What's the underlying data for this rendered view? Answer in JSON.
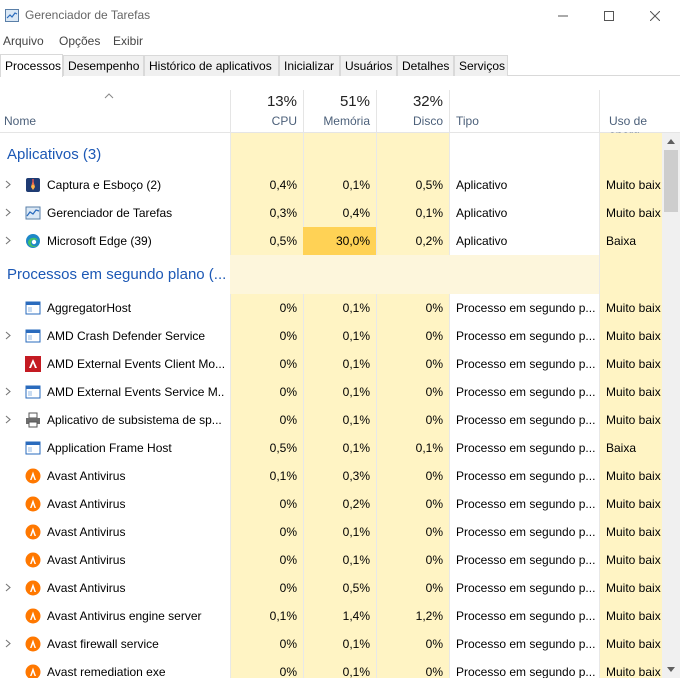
{
  "window": {
    "title": "Gerenciador de Tarefas",
    "minimize": "—",
    "maximize": "☐",
    "close": "✕"
  },
  "menu": [
    "Arquivo",
    "Opções",
    "Exibir"
  ],
  "tabs": [
    "Processos",
    "Desempenho",
    "Histórico de aplicativos",
    "Inicializar",
    "Usuários",
    "Detalhes",
    "Serviços"
  ],
  "active_tab": "Processos",
  "columns": {
    "name": "Nome",
    "cpu": {
      "label": "CPU",
      "pct": "13%"
    },
    "memory": {
      "label": "Memória",
      "pct": "51%"
    },
    "disk": {
      "label": "Disco",
      "pct": "32%"
    },
    "type": "Tipo",
    "energy": "Uso de energ"
  },
  "groups": {
    "apps": "Aplicativos (3)",
    "background": "Processos em segundo plano (..."
  },
  "apps": [
    {
      "name": "Captura e Esboço (2)",
      "cpu": "0,4%",
      "mem": "0,1%",
      "disk": "0,5%",
      "type": "Aplicativo",
      "energy": "Muito baix",
      "icon": "snip-sketch-icon",
      "expand": true,
      "mem_heat": 0
    },
    {
      "name": "Gerenciador de Tarefas",
      "cpu": "0,3%",
      "mem": "0,4%",
      "disk": "0,1%",
      "type": "Aplicativo",
      "energy": "Muito baix",
      "icon": "task-manager-icon",
      "expand": true,
      "mem_heat": 0
    },
    {
      "name": "Microsoft Edge (39)",
      "cpu": "0,5%",
      "mem": "30,0%",
      "disk": "0,2%",
      "type": "Aplicativo",
      "energy": "Baixa",
      "icon": "edge-icon",
      "expand": true,
      "mem_heat": 2
    }
  ],
  "background": [
    {
      "name": "AggregatorHost",
      "cpu": "0%",
      "mem": "0,1%",
      "disk": "0%",
      "type": "Processo em segundo p...",
      "energy": "Muito baix",
      "icon": "window-app-icon",
      "expand": false
    },
    {
      "name": "AMD Crash Defender Service",
      "cpu": "0%",
      "mem": "0,1%",
      "disk": "0%",
      "type": "Processo em segundo p...",
      "energy": "Muito baix",
      "icon": "window-app-icon",
      "expand": true
    },
    {
      "name": "AMD External Events Client Mo...",
      "cpu": "0%",
      "mem": "0,1%",
      "disk": "0%",
      "type": "Processo em segundo p...",
      "energy": "Muito baix",
      "icon": "amd-icon",
      "expand": false
    },
    {
      "name": "AMD External Events Service M...",
      "cpu": "0%",
      "mem": "0,1%",
      "disk": "0%",
      "type": "Processo em segundo p...",
      "energy": "Muito baix",
      "icon": "window-app-icon",
      "expand": true
    },
    {
      "name": "Aplicativo de subsistema de sp...",
      "cpu": "0%",
      "mem": "0,1%",
      "disk": "0%",
      "type": "Processo em segundo p...",
      "energy": "Muito baix",
      "icon": "printer-icon",
      "expand": true
    },
    {
      "name": "Application Frame Host",
      "cpu": "0,5%",
      "mem": "0,1%",
      "disk": "0,1%",
      "type": "Processo em segundo p...",
      "energy": "Baixa",
      "icon": "window-app-icon",
      "expand": false
    },
    {
      "name": "Avast Antivirus",
      "cpu": "0,1%",
      "mem": "0,3%",
      "disk": "0%",
      "type": "Processo em segundo p...",
      "energy": "Muito baix",
      "icon": "avast-icon",
      "expand": false
    },
    {
      "name": "Avast Antivirus",
      "cpu": "0%",
      "mem": "0,2%",
      "disk": "0%",
      "type": "Processo em segundo p...",
      "energy": "Muito baix",
      "icon": "avast-icon",
      "expand": false
    },
    {
      "name": "Avast Antivirus",
      "cpu": "0%",
      "mem": "0,1%",
      "disk": "0%",
      "type": "Processo em segundo p...",
      "energy": "Muito baix",
      "icon": "avast-icon",
      "expand": false
    },
    {
      "name": "Avast Antivirus",
      "cpu": "0%",
      "mem": "0,1%",
      "disk": "0%",
      "type": "Processo em segundo p...",
      "energy": "Muito baix",
      "icon": "avast-icon",
      "expand": false
    },
    {
      "name": "Avast Antivirus",
      "cpu": "0%",
      "mem": "0,5%",
      "disk": "0%",
      "type": "Processo em segundo p...",
      "energy": "Muito baix",
      "icon": "avast-icon",
      "expand": true
    },
    {
      "name": "Avast Antivirus engine server",
      "cpu": "0,1%",
      "mem": "1,4%",
      "disk": "1,2%",
      "type": "Processo em segundo p...",
      "energy": "Muito baix",
      "icon": "avast-icon",
      "expand": false
    },
    {
      "name": "Avast firewall service",
      "cpu": "0%",
      "mem": "0,1%",
      "disk": "0%",
      "type": "Processo em segundo p...",
      "energy": "Muito baix",
      "icon": "avast-icon",
      "expand": true
    },
    {
      "name": "Avast remediation exe",
      "cpu": "0%",
      "mem": "0,1%",
      "disk": "0%",
      "type": "Processo em segundo p...",
      "energy": "Muito baix",
      "icon": "avast-icon",
      "expand": false
    }
  ],
  "colors": {
    "heat_light": "#fff4c4",
    "heat_faint": "#fdf6dc",
    "heat_mid": "#fde9a8",
    "heat_strong": "#ffd255",
    "group_blue": "#1c58b5",
    "header_label": "#4c607a"
  }
}
